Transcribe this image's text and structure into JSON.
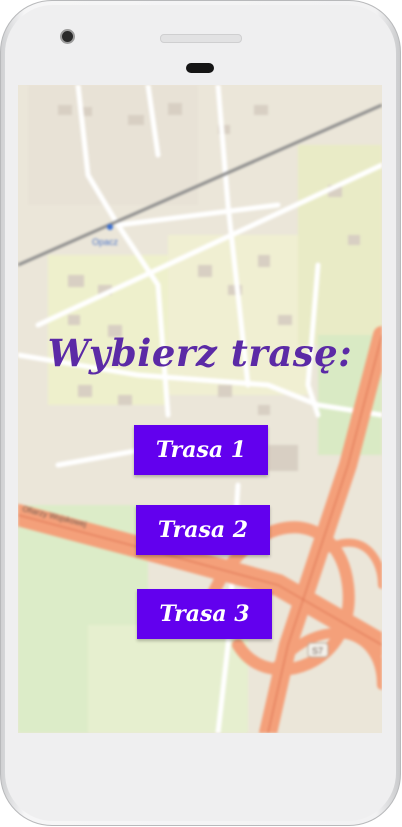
{
  "screen": {
    "title": "Wybierz trasę:",
    "buttons": [
      {
        "label": "Trasa 1"
      },
      {
        "label": "Trasa 2"
      },
      {
        "label": "Trasa 3"
      }
    ]
  },
  "map": {
    "labels": {
      "district": "Opacz",
      "road": "Ofiarzy Wojskowej",
      "route_badge": "S7"
    }
  },
  "colors": {
    "title": "#5b2aa6",
    "button_bg": "#6200ee",
    "button_text": "#ffffff",
    "motorway": "#f4a07a"
  }
}
